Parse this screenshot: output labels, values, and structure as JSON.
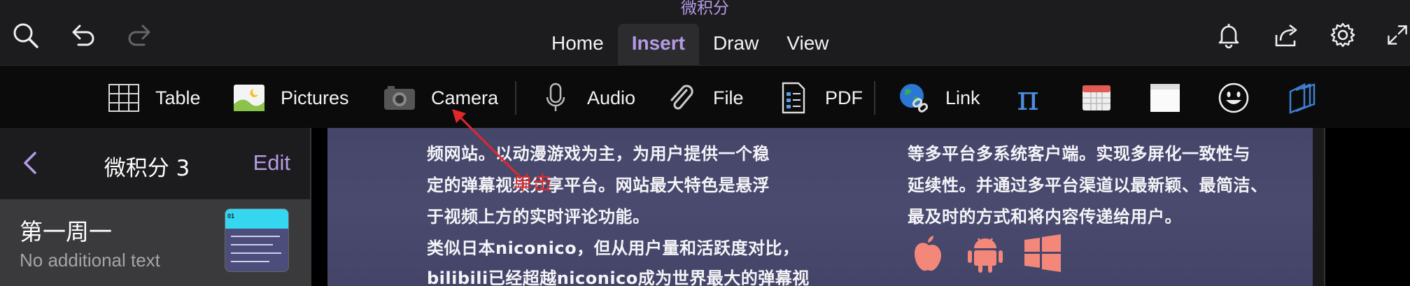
{
  "app": {
    "title": "微积分"
  },
  "toolbar_icons": [
    "search-icon",
    "undo-icon",
    "redo-icon",
    "bell-icon",
    "share-icon",
    "gear-icon",
    "expand-icon"
  ],
  "tabs": [
    {
      "label": "Home",
      "active": false
    },
    {
      "label": "Insert",
      "active": true
    },
    {
      "label": "Draw",
      "active": false
    },
    {
      "label": "View",
      "active": false
    }
  ],
  "ribbon": {
    "table": "Table",
    "pictures": "Pictures",
    "camera": "Camera",
    "audio": "Audio",
    "file": "File",
    "pdf": "PDF",
    "link": "Link",
    "extra_icons": [
      "pi-equation-icon",
      "calendar-icon",
      "sticky-note-icon",
      "emoji-icon",
      "stack-icon"
    ]
  },
  "sidebar": {
    "title": "微积分 3",
    "edit_label": "Edit",
    "pages": [
      {
        "title": "第一周一",
        "subtitle": "No additional text",
        "thumb_label": "01"
      }
    ]
  },
  "canvas": {
    "left_lines": [
      "频网站。以动漫游戏为主，为用户提供一个稳",
      "定的弹幕视频分享平台。网站最大特色是悬浮",
      "于视频上方的实时评论功能。",
      " 类似日本niconico，但从用户量和活跃度对比，",
      "bilibili已经超越niconico成为世界最大的弹幕视"
    ],
    "right_lines": [
      "等多平台多系统客户端。实现多屏化一致性与",
      "延续性。并通过多平台渠道以最新颖、最简洁、",
      "最及时的方式和将内容传递给用户。"
    ],
    "annotation": "单击",
    "platform_icons": [
      "apple-icon",
      "android-icon",
      "windows-icon"
    ]
  },
  "colors": {
    "accent": "#b59be6",
    "annotation_red": "#e0282a",
    "slide_bg": "#46466b",
    "platform_icon": "#f3877a"
  }
}
